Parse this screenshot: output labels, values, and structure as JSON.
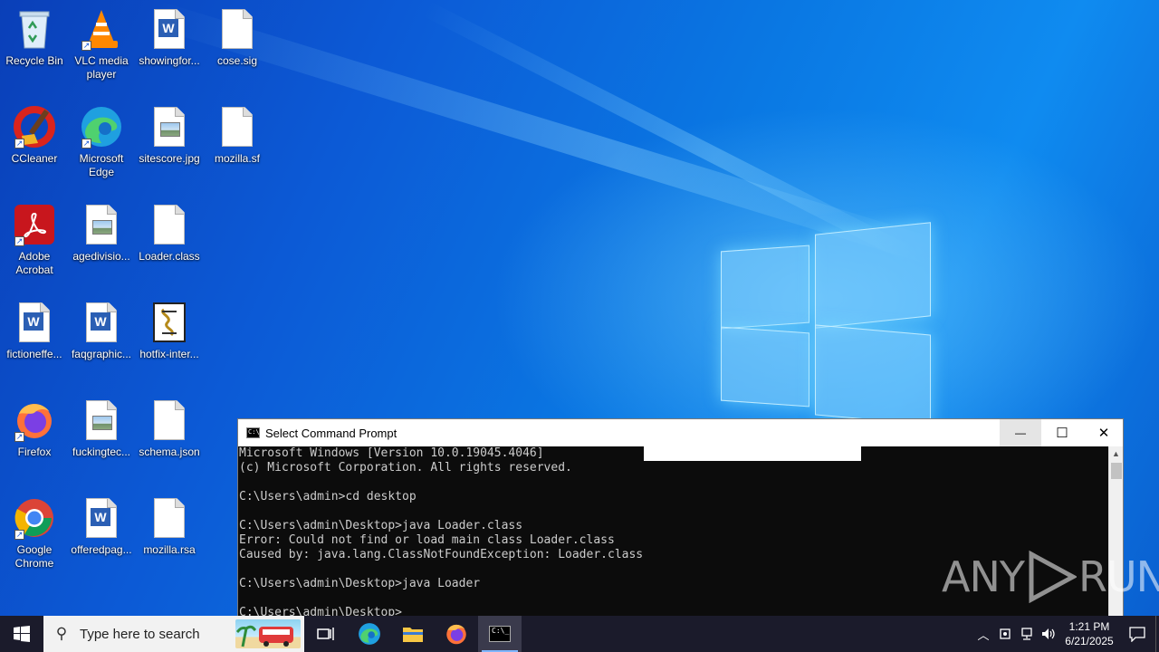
{
  "desktop": {
    "icons": [
      {
        "label": "Recycle Bin",
        "icon": "recycle-bin-icon"
      },
      {
        "label": "VLC media player",
        "icon": "vlc-icon"
      },
      {
        "label": "showingfor...",
        "icon": "word-document-icon"
      },
      {
        "label": "cose.sig",
        "icon": "blank-file-icon"
      },
      {
        "label": "CCleaner",
        "icon": "ccleaner-icon"
      },
      {
        "label": "Microsoft Edge",
        "icon": "edge-icon"
      },
      {
        "label": "sitescore.jpg",
        "icon": "image-file-icon"
      },
      {
        "label": "mozilla.sf",
        "icon": "blank-file-icon"
      },
      {
        "label": "Adobe Acrobat",
        "icon": "acrobat-icon"
      },
      {
        "label": "agedivisio...",
        "icon": "image-file-icon"
      },
      {
        "label": "Loader.class",
        "icon": "blank-file-icon"
      },
      {
        "label": "fictioneffe...",
        "icon": "word-document-icon"
      },
      {
        "label": "faqgraphic...",
        "icon": "word-document-icon"
      },
      {
        "label": "hotfix-inter...",
        "icon": "script-file-icon"
      },
      {
        "label": "Firefox",
        "icon": "firefox-icon"
      },
      {
        "label": "fuckingtec...",
        "icon": "image-file-icon"
      },
      {
        "label": "schema.json",
        "icon": "blank-file-icon"
      },
      {
        "label": "Google Chrome",
        "icon": "chrome-icon"
      },
      {
        "label": "offeredpag...",
        "icon": "word-document-icon"
      },
      {
        "label": "mozilla.rsa",
        "icon": "blank-file-icon"
      }
    ]
  },
  "cmd_window": {
    "title": "Select Command Prompt",
    "minimize": "—",
    "maximize": "☐",
    "close": "✕",
    "console_lines": [
      "Microsoft Windows [Version 10.0.19045.4046]",
      "(c) Microsoft Corporation. All rights reserved.",
      "",
      "C:\\Users\\admin>cd desktop",
      "",
      "C:\\Users\\admin\\Desktop>java Loader.class",
      "Error: Could not find or load main class Loader.class",
      "Caused by: java.lang.ClassNotFoundException: Loader.class",
      "",
      "C:\\Users\\admin\\Desktop>java Loader",
      "",
      "C:\\Users\\admin\\Desktop>"
    ],
    "colors": {
      "background": "#0c0c0c",
      "text": "#cccccc"
    }
  },
  "watermark": {
    "text_left": "ANY",
    "text_right": "RUN"
  },
  "taskbar": {
    "search_placeholder": "Type here to search",
    "pinned": [
      {
        "name": "start",
        "icon": "windows-start-icon"
      },
      {
        "name": "task-view",
        "icon": "task-view-icon"
      },
      {
        "name": "edge",
        "icon": "edge-icon"
      },
      {
        "name": "file-explorer",
        "icon": "folder-icon"
      },
      {
        "name": "firefox",
        "icon": "firefox-icon"
      },
      {
        "name": "command-prompt",
        "icon": "cmd-icon",
        "active": true
      }
    ],
    "clock": {
      "time": "1:21 PM",
      "date": "6/21/2025"
    },
    "accent": "#1b1b2b"
  }
}
